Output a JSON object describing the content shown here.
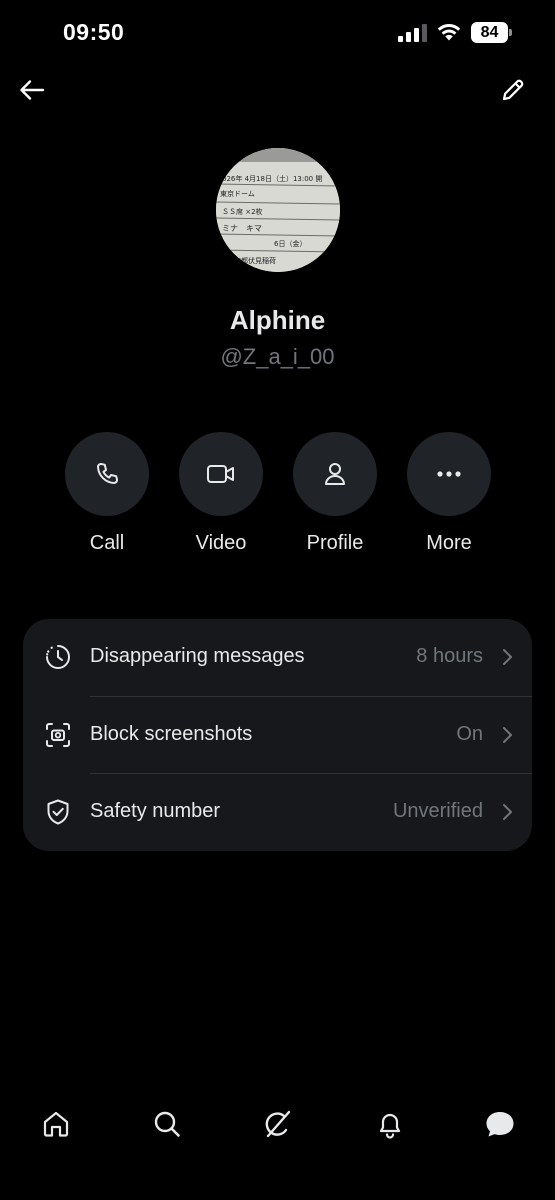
{
  "status_bar": {
    "time": "09:50",
    "battery": "84"
  },
  "header": {
    "back_icon": "arrow-left-icon",
    "edit_icon": "pencil-icon"
  },
  "profile": {
    "avatar_icon": "ticket-photo-avatar",
    "avatar_text": [
      "026年 4月18日（土）13:00 開",
      "東京ドーム",
      "ＳＳ席 ×2枚",
      "ミナ　キマ",
      "6日（金）",
      "京都伏見稲荷"
    ],
    "display_name": "Alphine",
    "handle": "@Z_a_i_00"
  },
  "actions": [
    {
      "label": "Call",
      "icon": "phone-icon"
    },
    {
      "label": "Video",
      "icon": "video-camera-icon"
    },
    {
      "label": "Profile",
      "icon": "person-icon"
    },
    {
      "label": "More",
      "icon": "more-dots-icon"
    }
  ],
  "settings": [
    {
      "label": "Disappearing messages",
      "value": "8 hours",
      "icon": "timer-icon"
    },
    {
      "label": "Block screenshots",
      "value": "On",
      "icon": "camera-frame-icon"
    },
    {
      "label": "Safety number",
      "value": "Unverified",
      "icon": "shield-check-icon"
    }
  ],
  "bottom_nav": [
    {
      "icon": "home-icon"
    },
    {
      "icon": "search-icon"
    },
    {
      "icon": "grok-icon"
    },
    {
      "icon": "bell-icon"
    },
    {
      "icon": "chat-bubble-icon"
    }
  ],
  "colors": {
    "background": "#000000",
    "card": "#16181c",
    "action_circle": "#202327",
    "primary_text": "#e7e9ea",
    "secondary_text": "#71767b",
    "divider": "#2f3336"
  }
}
